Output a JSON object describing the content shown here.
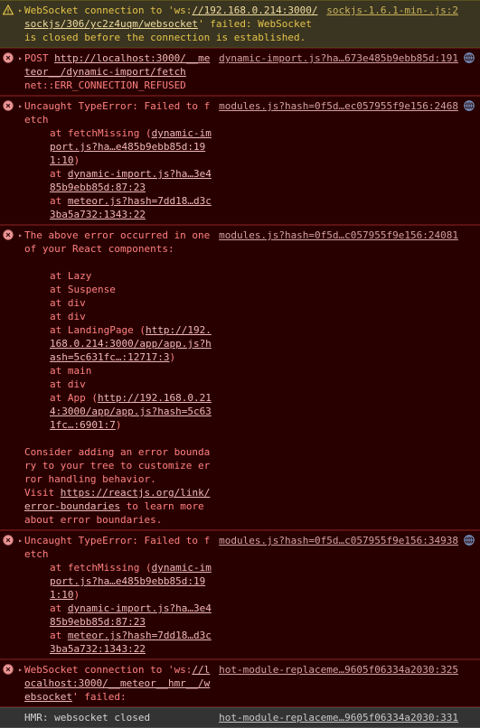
{
  "console": {
    "app": "Chrome DevTools Console",
    "theme": {
      "warning_bg": "#3a3520",
      "error_bg": "#290000",
      "info_bg": "#333333",
      "warning_text": "#e3c34a",
      "error_text": "#ff8080",
      "info_text": "#d4d4d4",
      "link": "#f0b8b8"
    },
    "entries": [
      {
        "level": "warning",
        "icon": "warning-triangle-icon",
        "expander": "▸",
        "text_before_link": "WebSocket connection to 'ws:",
        "inline_link": "//192.168.0.214:3000/sockjs/306/yc2z4uqm/websocket",
        "text_after_link": "' failed: WebSocket is closed before the connection is established.",
        "source": "sockjs-1.6.1-min-.js:2",
        "badge": null
      },
      {
        "level": "error",
        "icon": "error-circle-icon",
        "expander": "▸",
        "method": "POST",
        "inline_link": "http://localhost:3000/__meteor__/dynamic-import/fetch",
        "net_error": "net::ERR_CONNECTION_REFUSED",
        "source": "dynamic-import.js?ha…673e485b9ebb85d:191",
        "badge": "network-issue-icon"
      },
      {
        "level": "error",
        "icon": "error-circle-icon",
        "expander": "▸",
        "text": "Uncaught TypeError: Failed to fetch",
        "stack": [
          {
            "prefix": "at fetchMissing (",
            "link": "dynamic-import.js?ha…e485b9ebb85d:191:10",
            "suffix": ")"
          },
          {
            "prefix": "at ",
            "link": "dynamic-import.js?ha…3e485b9ebb85d:87:23",
            "suffix": ""
          },
          {
            "prefix": "at ",
            "link": "meteor.js?hash=7dd18…d3c3ba5a732:1343:22",
            "suffix": ""
          }
        ],
        "source": "modules.js?hash=0f5d…ec057955f9e156:2468",
        "badge": "network-issue-icon"
      },
      {
        "level": "error",
        "icon": "error-circle-icon",
        "expander": "▸",
        "text": "The above error occurred in one of your React components:",
        "stack": [
          {
            "prefix": "at Lazy",
            "link": "",
            "suffix": ""
          },
          {
            "prefix": "at Suspense",
            "link": "",
            "suffix": ""
          },
          {
            "prefix": "at div",
            "link": "",
            "suffix": ""
          },
          {
            "prefix": "at div",
            "link": "",
            "suffix": ""
          },
          {
            "prefix": "at LandingPage (",
            "link": "http://192.168.0.214:3000/app/app.js?hash=5c631fc…:12717:3",
            "suffix": ")"
          },
          {
            "prefix": "at main",
            "link": "",
            "suffix": ""
          },
          {
            "prefix": "at div",
            "link": "",
            "suffix": ""
          },
          {
            "prefix": "at App (",
            "link": "http://192.168.0.214:3000/app/app.js?hash=5c631fc…:6901:7",
            "suffix": ")"
          }
        ],
        "advice_line1": "Consider adding an error boundary to your tree to customize error handling behavior.",
        "advice_visit_prefix": "Visit ",
        "advice_link": "https://reactjs.org/link/error-boundaries",
        "advice_visit_suffix": " to learn more about error boundaries.",
        "source": "modules.js?hash=0f5d…c057955f9e156:24081",
        "badge": null
      },
      {
        "level": "error",
        "icon": "error-circle-icon",
        "expander": "▸",
        "text": "Uncaught TypeError: Failed to fetch",
        "stack": [
          {
            "prefix": "at fetchMissing (",
            "link": "dynamic-import.js?ha…e485b9ebb85d:191:10",
            "suffix": ")"
          },
          {
            "prefix": "at ",
            "link": "dynamic-import.js?ha…3e485b9ebb85d:87:23",
            "suffix": ""
          },
          {
            "prefix": "at ",
            "link": "meteor.js?hash=7dd18…d3c3ba5a732:1343:22",
            "suffix": ""
          }
        ],
        "source": "modules.js?hash=0f5d…c057955f9e156:34938",
        "badge": "network-issue-icon"
      },
      {
        "level": "error",
        "icon": "error-circle-icon",
        "expander": "▸",
        "text_before_link": "WebSocket connection to 'ws:",
        "inline_link": "//localhost:3000/__meteor__hmr__/websocket",
        "text_after_link": "' failed:",
        "source": "hot-module-replaceme…9605f06334a2030:325",
        "badge": null
      },
      {
        "level": "info",
        "icon": null,
        "expander": null,
        "text": "HMR: websocket closed",
        "source": "hot-module-replaceme…9605f06334a2030:331",
        "badge": null
      }
    ]
  }
}
